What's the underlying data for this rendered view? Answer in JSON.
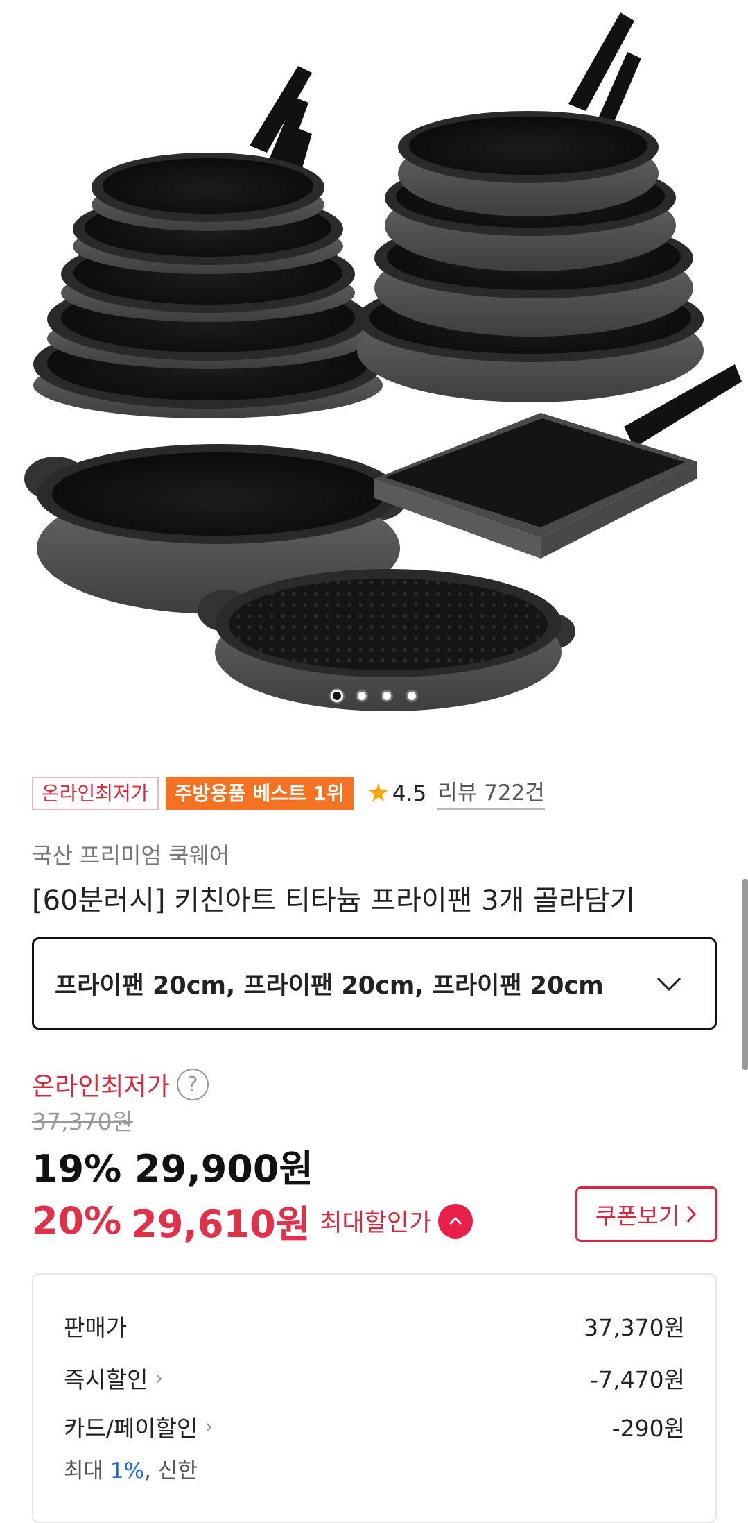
{
  "hero": {
    "image_alt": "Frying pan set product photo",
    "carousel": {
      "current": 1,
      "total": 4
    }
  },
  "badges": {
    "lowest": "온라인최저가",
    "best": "주방용품 베스트 1위",
    "star_icon": "star-icon",
    "rating": "4.5",
    "reviews": "리뷰 722건"
  },
  "product": {
    "brand": "국산 프리미엄 쿡웨어",
    "title": "[60분러시] 키친아트 티타늄 프라이팬 3개 골라담기"
  },
  "option": {
    "selected": "프라이팬 20cm, 프라이팬 20cm, 프라이팬 20cm",
    "icon": "chevron-down-icon"
  },
  "price": {
    "lowest_label": "온라인최저가",
    "help": "?",
    "original": "37,370원",
    "sale": "19% 29,900원",
    "max_rate": "20%",
    "max_price": "29,610원",
    "max_label": "최대할인가",
    "coupon_label": "쿠폰보기",
    "accent": "#e0304a"
  },
  "breakdown": {
    "rows": [
      {
        "label": "판매가",
        "value": "37,370원",
        "chevron": false
      },
      {
        "label": "즉시할인",
        "value": "-7,470원",
        "chevron": true
      },
      {
        "label": "카드/페이할인",
        "value": "-290원",
        "chevron": true
      }
    ],
    "card_note_prefix": "최대 ",
    "card_note_rate": "1%",
    "card_note_suffix": ", 신한"
  }
}
